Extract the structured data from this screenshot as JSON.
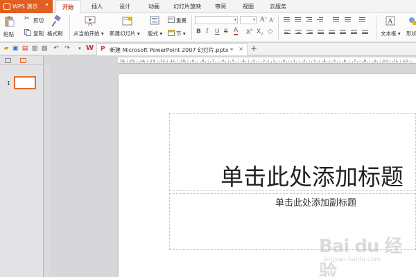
{
  "app": {
    "name": "WPS 演示",
    "brand_color": "#e15f21"
  },
  "menu_tabs": [
    {
      "label": "开始",
      "active": true
    },
    {
      "label": "插入",
      "active": false
    },
    {
      "label": "设计",
      "active": false
    },
    {
      "label": "动画",
      "active": false
    },
    {
      "label": "幻灯片放映",
      "active": false
    },
    {
      "label": "审阅",
      "active": false
    },
    {
      "label": "视图",
      "active": false
    },
    {
      "label": "云服务",
      "active": false
    }
  ],
  "ribbon": {
    "paste": "粘贴",
    "cut": "剪切",
    "copy": "复制",
    "format_painter": "格式刷",
    "from_current": "从当前开始",
    "new_slide": "新建幻灯片",
    "layout": "版式",
    "reset": "重置",
    "section": "节",
    "text_box": "文本框",
    "shape": "形状"
  },
  "quick_access_icons": [
    "folder-open-icon",
    "save-icon",
    "export-pdf-icon",
    "print-icon",
    "print-preview-icon",
    "undo-icon",
    "redo-icon",
    "dropdown-icon"
  ],
  "document_tab": {
    "title": "新建 Microsoft PowerPoint 2007 幻灯片.pptx *",
    "close": "×"
  },
  "new_tab_symbol": "+",
  "slides_pane": {
    "slide_number": "1",
    "accent": "#e46b2c"
  },
  "ruler_labels": [
    "16",
    "15",
    "14",
    "13",
    "12",
    "11",
    "10",
    "9",
    "8",
    "7",
    "6",
    "5",
    "4",
    "3",
    "2",
    "1",
    "0",
    "1",
    "2",
    "3",
    "4",
    "5",
    "6",
    "7",
    "8",
    "9",
    "10",
    "11",
    "12"
  ],
  "slide": {
    "title_placeholder": "单击此处添加标题",
    "subtitle_placeholder": "单击此处添加副标题"
  },
  "watermark": {
    "brand": "Bai du 经验",
    "url": "jingyan.baidu.com"
  }
}
